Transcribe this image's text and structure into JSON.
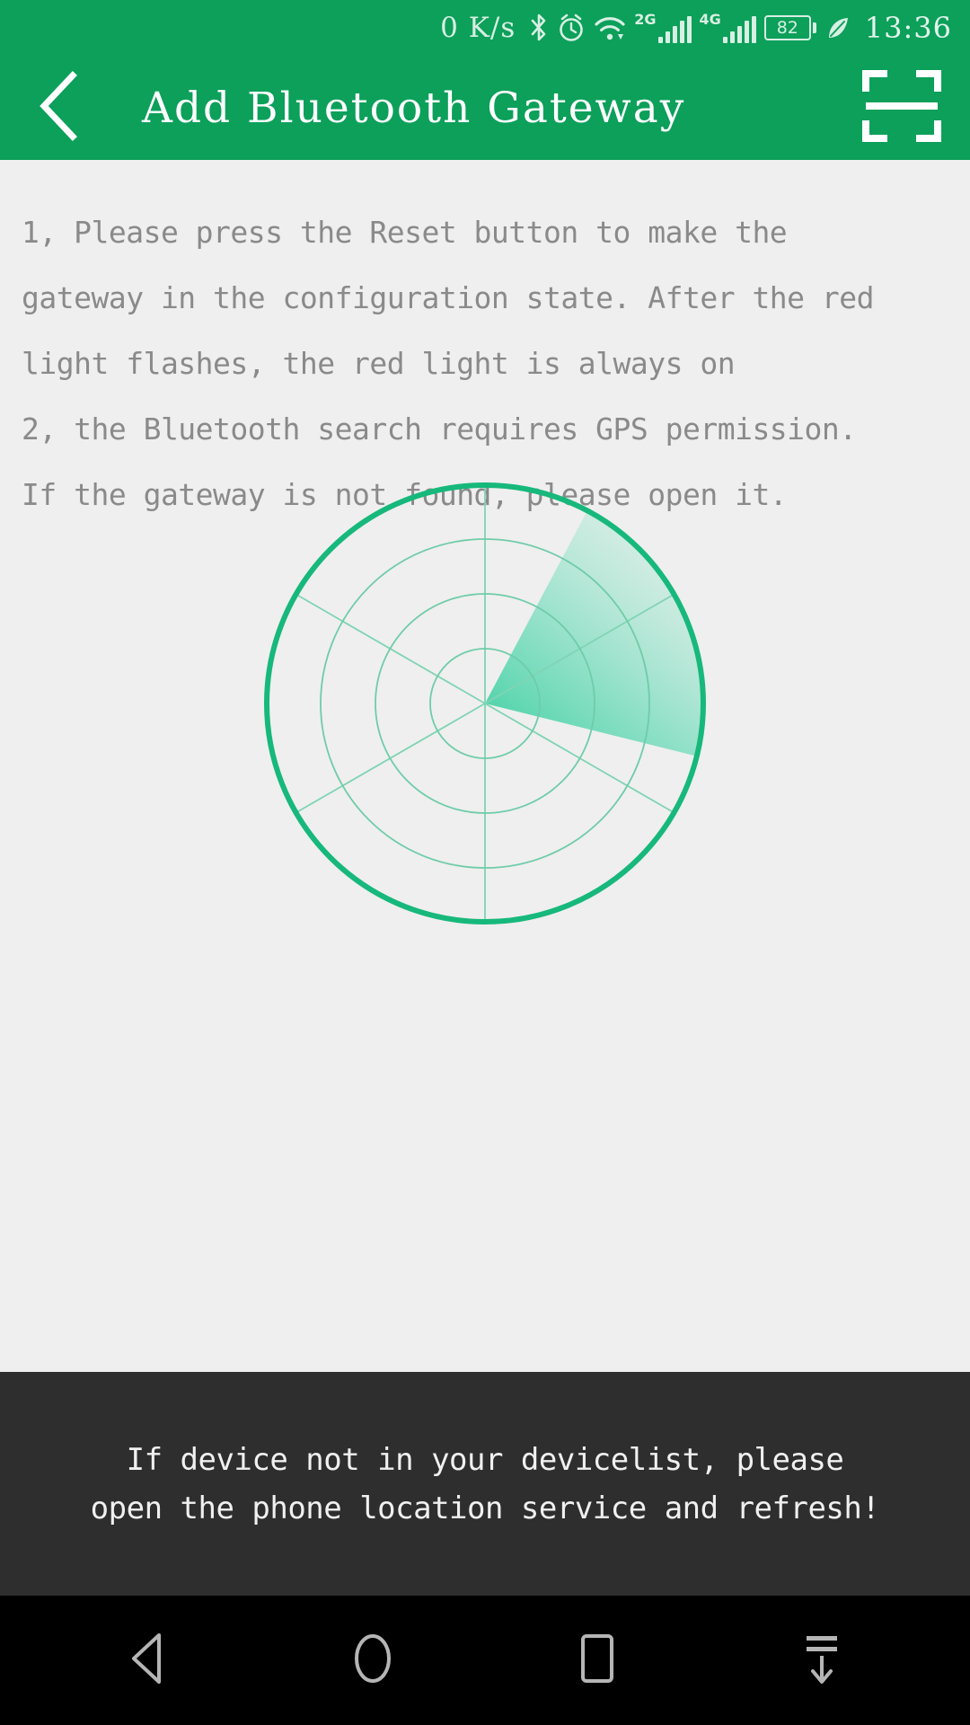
{
  "status_bar": {
    "network_speed": "0 K/s",
    "icons": [
      "bluetooth-icon",
      "alarm-icon",
      "wifi-icon"
    ],
    "sim1_network": "2G",
    "sim2_network": "4G",
    "battery_level": "82",
    "power_saving_icon": "leaf-icon",
    "time": "13:36"
  },
  "header": {
    "back_icon": "chevron-left-icon",
    "title": "Add Bluetooth Gateway",
    "scan_icon": "scan-qr-icon",
    "background_color": "#0CA05A"
  },
  "instructions": {
    "lines": [
      "1, Please press the Reset button to make the",
      "gateway in the configuration state. After the red",
      "light flashes, the red light is always on",
      "2, the Bluetooth search requires GPS permission.",
      "If the gateway is not found, please open it."
    ]
  },
  "radar": {
    "name": "bluetooth-scanning-radar",
    "ring_count": 4,
    "spoke_count": 3,
    "sweep_start_deg": 28,
    "sweep_end_deg": 76,
    "outer_color": "#1BB87A",
    "ring_color": "#66C9A4",
    "sweep_color": "#3FCFA0"
  },
  "toast": {
    "line1": "If device not in your devicelist, please",
    "line2": "open the phone location service and refresh!",
    "background_color": "#2e2e2e"
  },
  "nav_bar": {
    "buttons": [
      {
        "name": "nav-back-icon"
      },
      {
        "name": "nav-home-icon"
      },
      {
        "name": "nav-recents-icon"
      },
      {
        "name": "nav-pulldown-icon"
      }
    ]
  }
}
